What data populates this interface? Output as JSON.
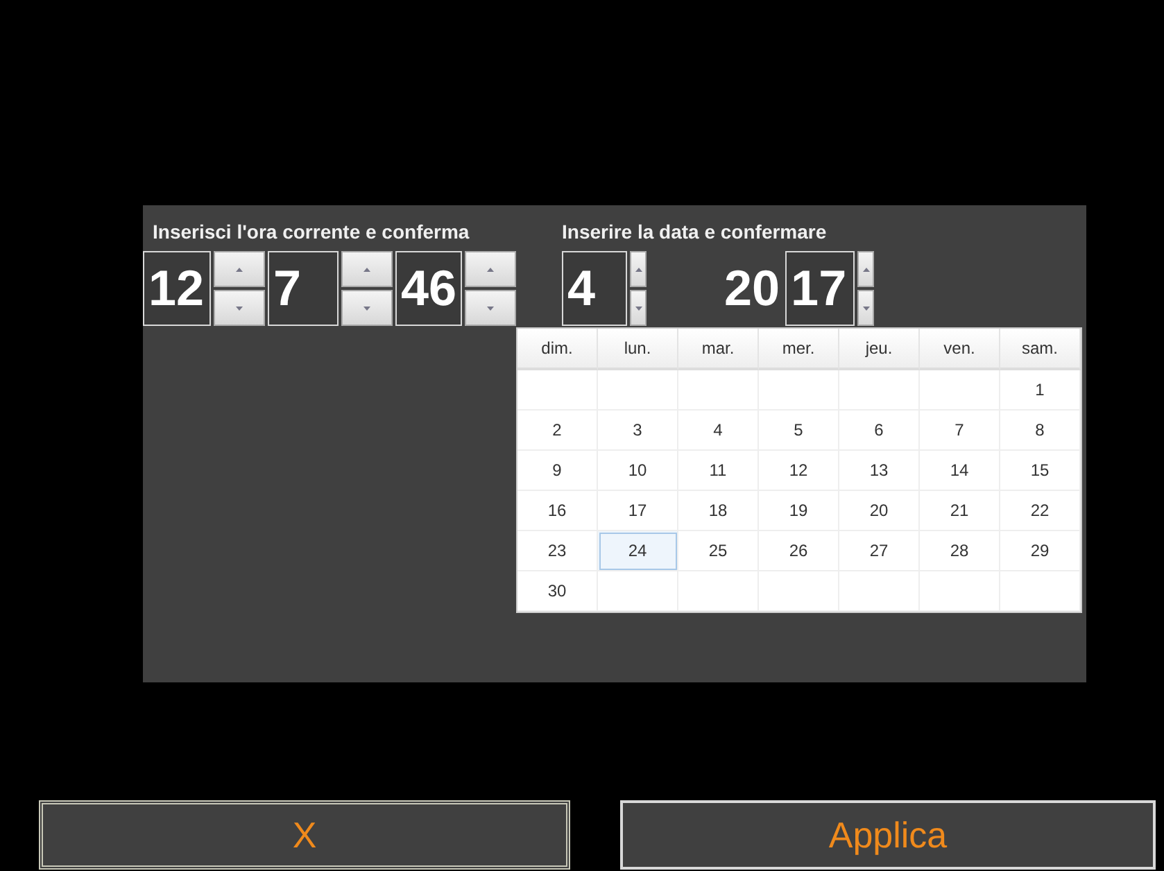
{
  "time": {
    "title": "Inserisci l'ora corrente e conferma",
    "fields": [
      {
        "value": "12"
      },
      {
        "value": "7"
      },
      {
        "value": "46"
      }
    ]
  },
  "date": {
    "title": "Inserire la data e confermare",
    "month": "4",
    "year_prefix": "20",
    "year": "17"
  },
  "calendar": {
    "weekdays": [
      "dim.",
      "lun.",
      "mar.",
      "mer.",
      "jeu.",
      "ven.",
      "sam."
    ],
    "weeks": [
      {
        "kind": "first",
        "days": [
          {
            "day": "1",
            "selected": false
          }
        ]
      },
      {
        "kind": "full",
        "days": [
          {
            "day": "2",
            "selected": false
          },
          {
            "day": "3",
            "selected": false
          },
          {
            "day": "4",
            "selected": false
          },
          {
            "day": "5",
            "selected": false
          },
          {
            "day": "6",
            "selected": false
          },
          {
            "day": "7",
            "selected": false
          },
          {
            "day": "8",
            "selected": false
          }
        ]
      },
      {
        "kind": "full",
        "days": [
          {
            "day": "9",
            "selected": false
          },
          {
            "day": "10",
            "selected": false
          },
          {
            "day": "11",
            "selected": false
          },
          {
            "day": "12",
            "selected": false
          },
          {
            "day": "13",
            "selected": false
          },
          {
            "day": "14",
            "selected": false
          },
          {
            "day": "15",
            "selected": false
          }
        ]
      },
      {
        "kind": "full",
        "days": [
          {
            "day": "16",
            "selected": false
          },
          {
            "day": "17",
            "selected": false
          },
          {
            "day": "18",
            "selected": false
          },
          {
            "day": "19",
            "selected": false
          },
          {
            "day": "20",
            "selected": false
          },
          {
            "day": "21",
            "selected": false
          },
          {
            "day": "22",
            "selected": false
          }
        ]
      },
      {
        "kind": "full",
        "days": [
          {
            "day": "23",
            "selected": false
          },
          {
            "day": "24",
            "selected": true
          },
          {
            "day": "25",
            "selected": false
          },
          {
            "day": "26",
            "selected": false
          },
          {
            "day": "27",
            "selected": false
          },
          {
            "day": "28",
            "selected": false
          },
          {
            "day": "29",
            "selected": false
          }
        ]
      },
      {
        "kind": "last",
        "days": [
          {
            "day": "30",
            "selected": false
          }
        ]
      }
    ]
  },
  "buttons": [
    {
      "label": "X",
      "kind": "cancel"
    },
    {
      "label": "Applica",
      "kind": "apply"
    }
  ]
}
